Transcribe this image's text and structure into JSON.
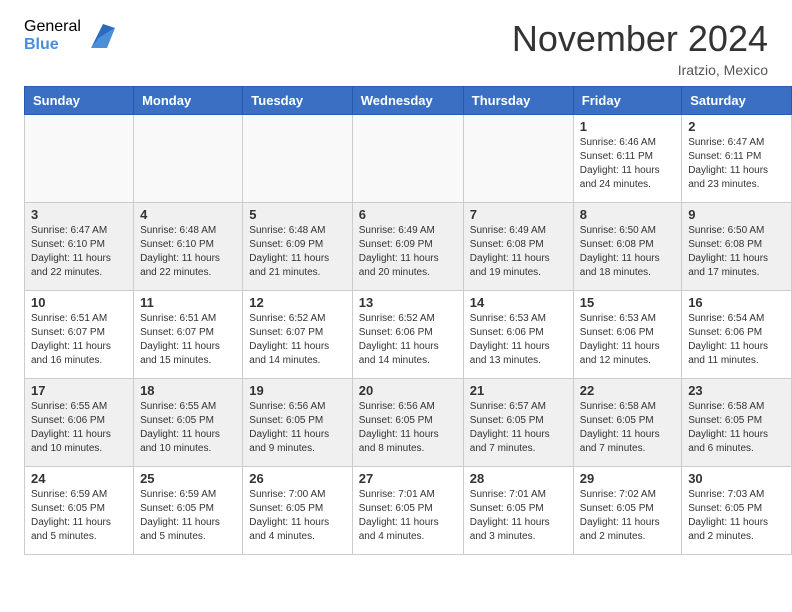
{
  "header": {
    "logo_general": "General",
    "logo_blue": "Blue",
    "month_title": "November 2024",
    "location": "Iratzio, Mexico"
  },
  "weekdays": [
    "Sunday",
    "Monday",
    "Tuesday",
    "Wednesday",
    "Thursday",
    "Friday",
    "Saturday"
  ],
  "weeks": [
    [
      {
        "day": "",
        "info": ""
      },
      {
        "day": "",
        "info": ""
      },
      {
        "day": "",
        "info": ""
      },
      {
        "day": "",
        "info": ""
      },
      {
        "day": "",
        "info": ""
      },
      {
        "day": "1",
        "info": "Sunrise: 6:46 AM\nSunset: 6:11 PM\nDaylight: 11 hours and 24 minutes."
      },
      {
        "day": "2",
        "info": "Sunrise: 6:47 AM\nSunset: 6:11 PM\nDaylight: 11 hours and 23 minutes."
      }
    ],
    [
      {
        "day": "3",
        "info": "Sunrise: 6:47 AM\nSunset: 6:10 PM\nDaylight: 11 hours and 22 minutes."
      },
      {
        "day": "4",
        "info": "Sunrise: 6:48 AM\nSunset: 6:10 PM\nDaylight: 11 hours and 22 minutes."
      },
      {
        "day": "5",
        "info": "Sunrise: 6:48 AM\nSunset: 6:09 PM\nDaylight: 11 hours and 21 minutes."
      },
      {
        "day": "6",
        "info": "Sunrise: 6:49 AM\nSunset: 6:09 PM\nDaylight: 11 hours and 20 minutes."
      },
      {
        "day": "7",
        "info": "Sunrise: 6:49 AM\nSunset: 6:08 PM\nDaylight: 11 hours and 19 minutes."
      },
      {
        "day": "8",
        "info": "Sunrise: 6:50 AM\nSunset: 6:08 PM\nDaylight: 11 hours and 18 minutes."
      },
      {
        "day": "9",
        "info": "Sunrise: 6:50 AM\nSunset: 6:08 PM\nDaylight: 11 hours and 17 minutes."
      }
    ],
    [
      {
        "day": "10",
        "info": "Sunrise: 6:51 AM\nSunset: 6:07 PM\nDaylight: 11 hours and 16 minutes."
      },
      {
        "day": "11",
        "info": "Sunrise: 6:51 AM\nSunset: 6:07 PM\nDaylight: 11 hours and 15 minutes."
      },
      {
        "day": "12",
        "info": "Sunrise: 6:52 AM\nSunset: 6:07 PM\nDaylight: 11 hours and 14 minutes."
      },
      {
        "day": "13",
        "info": "Sunrise: 6:52 AM\nSunset: 6:06 PM\nDaylight: 11 hours and 14 minutes."
      },
      {
        "day": "14",
        "info": "Sunrise: 6:53 AM\nSunset: 6:06 PM\nDaylight: 11 hours and 13 minutes."
      },
      {
        "day": "15",
        "info": "Sunrise: 6:53 AM\nSunset: 6:06 PM\nDaylight: 11 hours and 12 minutes."
      },
      {
        "day": "16",
        "info": "Sunrise: 6:54 AM\nSunset: 6:06 PM\nDaylight: 11 hours and 11 minutes."
      }
    ],
    [
      {
        "day": "17",
        "info": "Sunrise: 6:55 AM\nSunset: 6:06 PM\nDaylight: 11 hours and 10 minutes."
      },
      {
        "day": "18",
        "info": "Sunrise: 6:55 AM\nSunset: 6:05 PM\nDaylight: 11 hours and 10 minutes."
      },
      {
        "day": "19",
        "info": "Sunrise: 6:56 AM\nSunset: 6:05 PM\nDaylight: 11 hours and 9 minutes."
      },
      {
        "day": "20",
        "info": "Sunrise: 6:56 AM\nSunset: 6:05 PM\nDaylight: 11 hours and 8 minutes."
      },
      {
        "day": "21",
        "info": "Sunrise: 6:57 AM\nSunset: 6:05 PM\nDaylight: 11 hours and 7 minutes."
      },
      {
        "day": "22",
        "info": "Sunrise: 6:58 AM\nSunset: 6:05 PM\nDaylight: 11 hours and 7 minutes."
      },
      {
        "day": "23",
        "info": "Sunrise: 6:58 AM\nSunset: 6:05 PM\nDaylight: 11 hours and 6 minutes."
      }
    ],
    [
      {
        "day": "24",
        "info": "Sunrise: 6:59 AM\nSunset: 6:05 PM\nDaylight: 11 hours and 5 minutes."
      },
      {
        "day": "25",
        "info": "Sunrise: 6:59 AM\nSunset: 6:05 PM\nDaylight: 11 hours and 5 minutes."
      },
      {
        "day": "26",
        "info": "Sunrise: 7:00 AM\nSunset: 6:05 PM\nDaylight: 11 hours and 4 minutes."
      },
      {
        "day": "27",
        "info": "Sunrise: 7:01 AM\nSunset: 6:05 PM\nDaylight: 11 hours and 4 minutes."
      },
      {
        "day": "28",
        "info": "Sunrise: 7:01 AM\nSunset: 6:05 PM\nDaylight: 11 hours and 3 minutes."
      },
      {
        "day": "29",
        "info": "Sunrise: 7:02 AM\nSunset: 6:05 PM\nDaylight: 11 hours and 2 minutes."
      },
      {
        "day": "30",
        "info": "Sunrise: 7:03 AM\nSunset: 6:05 PM\nDaylight: 11 hours and 2 minutes."
      }
    ]
  ]
}
